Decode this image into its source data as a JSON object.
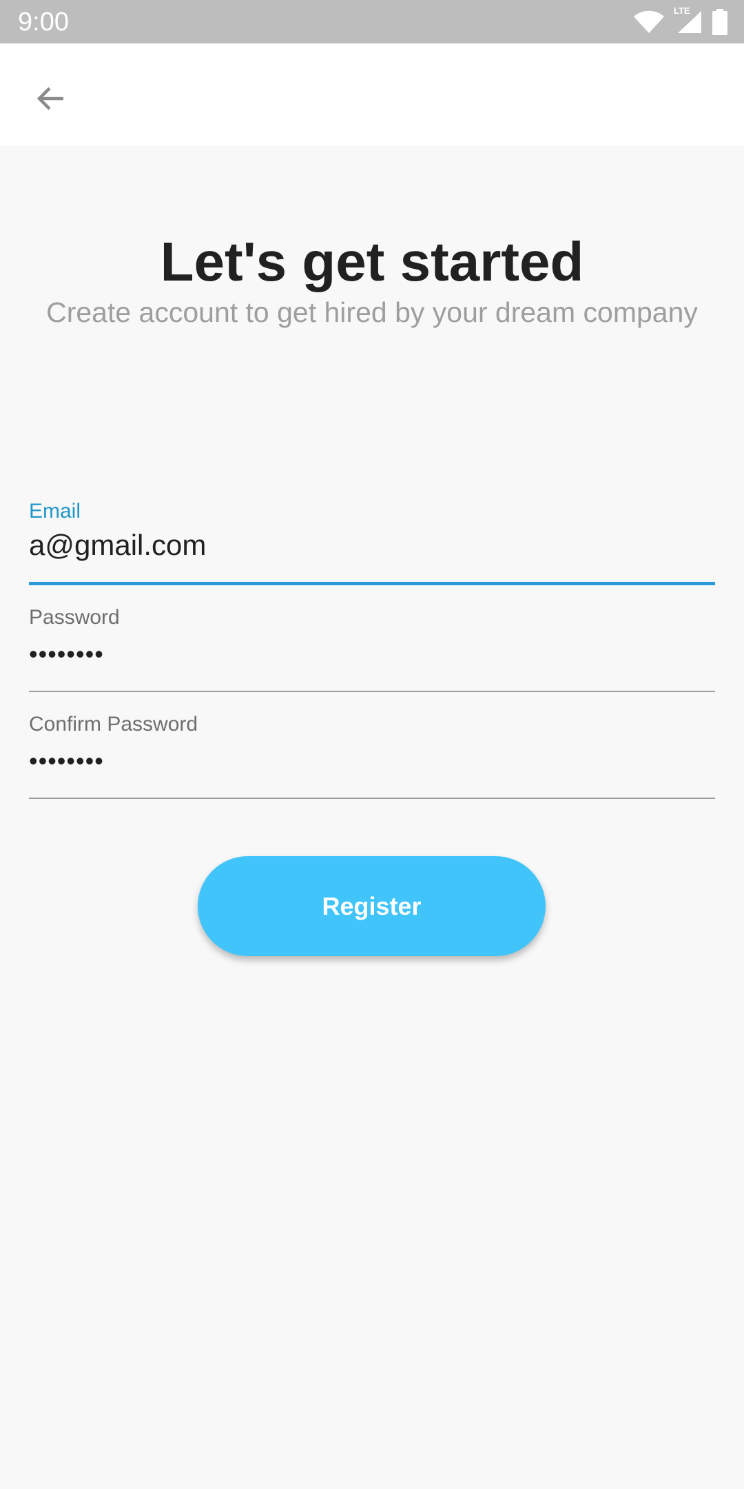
{
  "status_bar": {
    "time": "9:00",
    "network_label": "LTE",
    "icons": [
      "wifi-icon",
      "cellular-signal-icon",
      "battery-icon"
    ]
  },
  "app_bar": {
    "back_icon": "arrow-left-icon"
  },
  "header": {
    "title": "Let's get started",
    "subtitle": "Create account to get hired by your dream company"
  },
  "form": {
    "email": {
      "label": "Email",
      "value": "a@gmail.com",
      "focused": true
    },
    "password": {
      "label": "Password",
      "value": "••••••••"
    },
    "confirm_password": {
      "label": "Confirm Password",
      "value": "••••••••"
    },
    "submit_label": "Register"
  },
  "colors": {
    "accent": "#2196c8",
    "button": "#40c4fa",
    "background": "#f8f8f8",
    "status_bar": "#bdbdbd"
  }
}
